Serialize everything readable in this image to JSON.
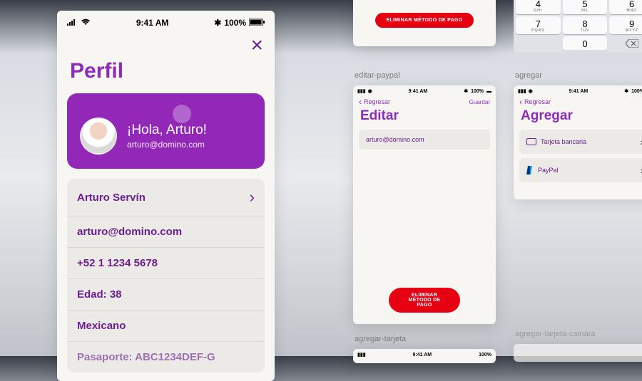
{
  "statusbar": {
    "time": "9:41 AM",
    "battery": "100%"
  },
  "profile": {
    "title": "Perfil",
    "greeting": "¡Hola, Arturo!",
    "hero_email": "arturo@domino.com",
    "rows": {
      "name": "Arturo Servín",
      "email": "arturo@domino.com",
      "phone": "+52 1 1234 5678",
      "age": "Edad: 38",
      "nationality": "Mexicano",
      "passport": "Pasaporte: ABC1234DEF-G"
    }
  },
  "delete_payment_label": "ELIMINAR MÉTODO DE PAGO",
  "labels": {
    "editar_paypal": "editar-paypal",
    "agregar": "agregar",
    "agregar_tarjeta": "agregar-tarjeta",
    "agregar_tarjeta_camara": "agregar-tarjeta-camara"
  },
  "back_label": "Regresar",
  "editar": {
    "title": "Editar",
    "email_value": "arturo@domino.com",
    "save_label": "Guardar"
  },
  "agregar_screen": {
    "title": "Agregar",
    "card_label": "Tarjeta bancaria",
    "paypal_label": "PayPal"
  },
  "keypad": {
    "k4": {
      "n": "4",
      "s": "GHI"
    },
    "k5": {
      "n": "5",
      "s": "JKL"
    },
    "k6": {
      "n": "6",
      "s": "MNO"
    },
    "k7": {
      "n": "7",
      "s": "PQRS"
    },
    "k8": {
      "n": "8",
      "s": "TUV"
    },
    "k9": {
      "n": "9",
      "s": "WXYZ"
    },
    "k0": {
      "n": "0",
      "s": ""
    }
  }
}
